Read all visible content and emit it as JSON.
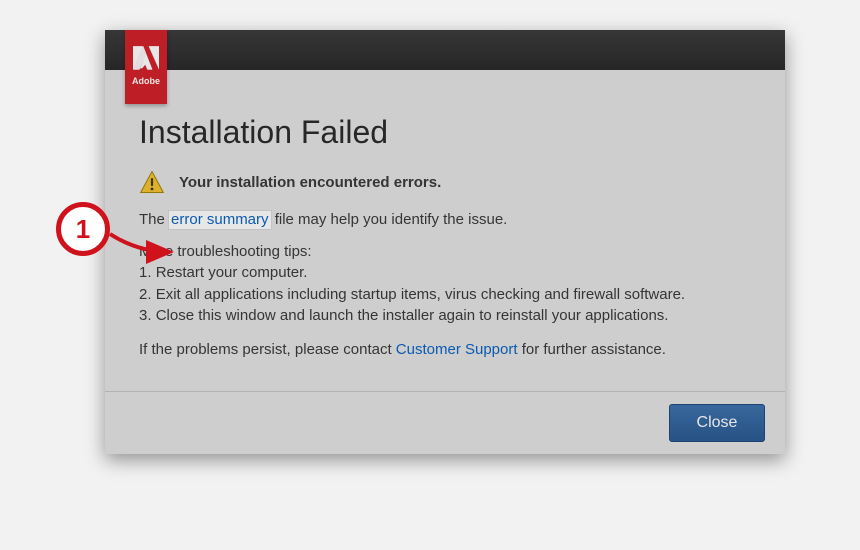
{
  "brand": "Adobe",
  "dialog": {
    "title": "Installation Failed",
    "alert_message": "Your installation encountered errors.",
    "summary_before": "The ",
    "summary_link": "error summary",
    "summary_after": " file may help you identify the issue.",
    "tips_heading": "More troubleshooting tips:",
    "tips": [
      "Restart your computer.",
      "Exit all applications including startup items, virus checking and firewall software.",
      "Close this window and launch the installer again to reinstall your applications."
    ],
    "persist_before": "If the problems persist, please contact ",
    "persist_link": "Customer Support",
    "persist_after": " for further assistance.",
    "close_label": "Close"
  },
  "annotation": {
    "number": "1"
  }
}
